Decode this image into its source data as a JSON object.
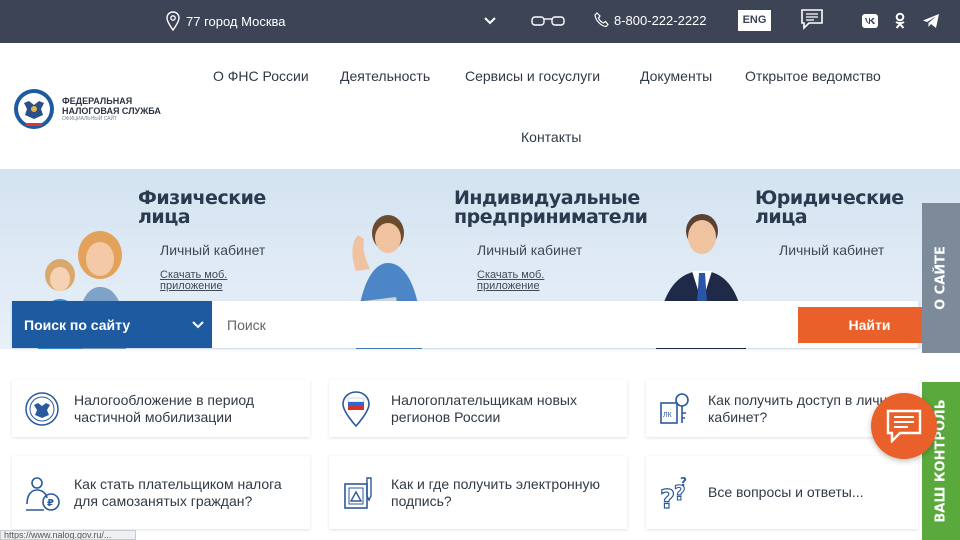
{
  "topbar": {
    "location": "77 город Москва",
    "phone": "8-800-222-2222",
    "lang": "ENG"
  },
  "header": {
    "logo_line1": "ФЕДЕРАЛЬНАЯ",
    "logo_line2": "НАЛОГОВАЯ СЛУЖБА",
    "logo_line3": "ОФИЦИАЛЬНЫЙ САЙТ",
    "nav": [
      "О ФНС России",
      "Деятельность",
      "Сервисы и госуслуги",
      "Документы",
      "Открытое ведомство",
      "Контакты"
    ]
  },
  "categories": [
    {
      "title1": "Физические",
      "title2": "лица",
      "cabinet": "Личный кабинет",
      "app1": "Скачать моб.",
      "app2": "приложение"
    },
    {
      "title1": "Индивидуальные",
      "title2": "предприниматели",
      "cabinet": "Личный кабинет",
      "app1": "Скачать моб.",
      "app2": "приложение"
    },
    {
      "title1": "Юридические",
      "title2": "лица",
      "cabinet": "Личный кабинет"
    }
  ],
  "search": {
    "scope": "Поиск по сайту",
    "placeholder": "Поиск",
    "button": "Найти"
  },
  "quicklinks": [
    "Налогообложение в период частичной мобилизации",
    "Налогоплательщикам новых регионов России",
    "Как получить доступ в личный кабинет?",
    "Как стать плательщиком налога для самозанятых граждан?",
    "Как и где получить электронную подпись?",
    "Все вопросы и ответы..."
  ],
  "sidetabs": {
    "about": "О САЙТЕ",
    "control": "ВАШ КОНТРОЛЬ"
  },
  "status_url": "https://www.nalog.gov.ru/...",
  "colors": {
    "topbar": "#3c4456",
    "brand_blue": "#1e5aa0",
    "accent_orange": "#e9602b",
    "side_gray": "#7d8a99",
    "side_green": "#5aa93c"
  }
}
